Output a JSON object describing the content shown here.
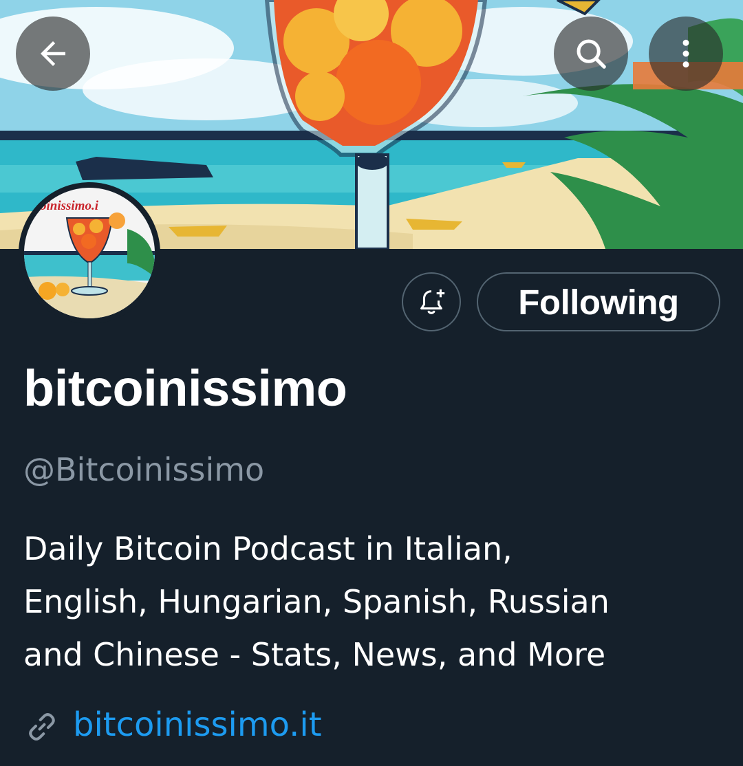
{
  "header": {
    "back_icon": "arrow-left-icon",
    "search_icon": "search-icon",
    "more_icon": "more-vertical-icon"
  },
  "banner": {
    "description_icon": "banner-image"
  },
  "avatar": {
    "logo_text": "itcoinissimo.i"
  },
  "actions": {
    "notify_icon": "bell-plus-icon",
    "following_label": "Following"
  },
  "profile": {
    "display_name": "bitcoinissimo",
    "handle": "@Bitcoinissimo",
    "bio": "Daily Bitcoin Podcast in Italian,\nEnglish, Hungarian, Spanish, Russian\nand Chinese - Stats, News, and More",
    "link_icon": "link-icon",
    "website": "bitcoinissimo.it"
  },
  "colors": {
    "background": "#15202b",
    "secondary_text": "#8b98a5",
    "link": "#1d9bf0",
    "border": "#536471"
  }
}
